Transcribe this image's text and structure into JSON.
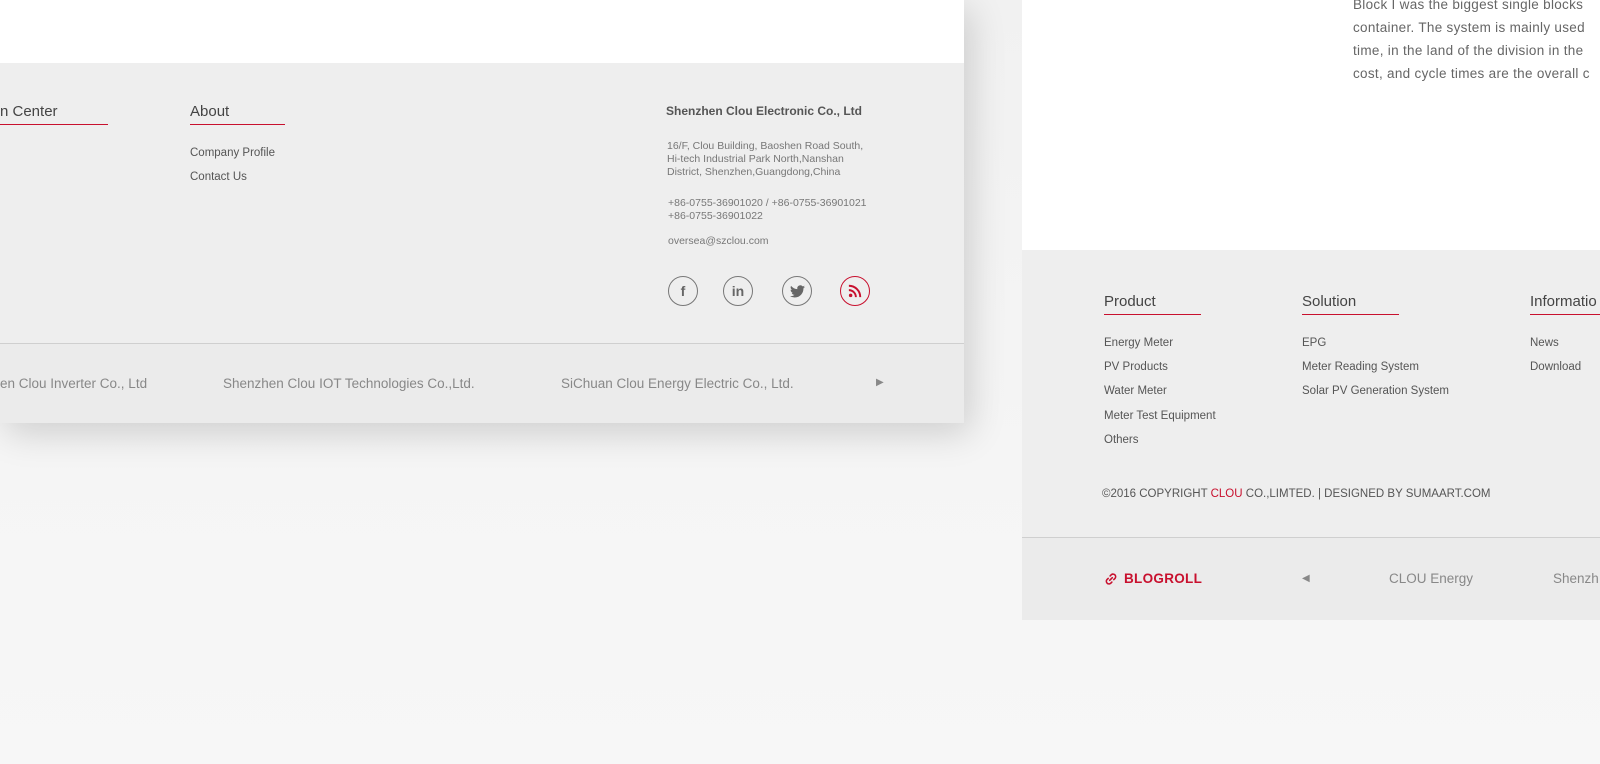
{
  "left_page": {
    "columns": [
      {
        "title": "n Center",
        "items": []
      },
      {
        "title": "About",
        "items": [
          "Company Profile",
          "Contact Us"
        ]
      }
    ],
    "company": {
      "name": "Shenzhen Clou Electronic Co., Ltd",
      "address": [
        "16/F, Clou Building, Baoshen Road South,",
        "Hi-tech Industrial Park North,Nanshan",
        "District, Shenzhen,Guangdong,China"
      ],
      "phones": [
        "+86-0755-36901020 / +86-0755-36901021",
        "+86-0755-36901022"
      ],
      "email": "oversea@szclou.com"
    },
    "social_icons": [
      "facebook-icon",
      "linkedin-icon",
      "twitter-icon",
      "rss-icon"
    ],
    "partner_links": [
      "en Clou Inverter Co., Ltd",
      "Shenzhen Clou IOT Technologies Co.,Ltd.",
      "SiChuan Clou Energy Electric Co., Ltd."
    ]
  },
  "right_page": {
    "intro_lines": [
      "Block I was the biggest single blocks",
      "container. The system is mainly used",
      "time, in the land of the division in the",
      "cost, and cycle times are the overall c"
    ],
    "columns": [
      {
        "title": "Product",
        "items": [
          "Energy Meter",
          "PV Products",
          "Water Meter",
          "Meter Test Equipment",
          "Others"
        ]
      },
      {
        "title": "Solution",
        "items": [
          "EPG",
          "Meter Reading System",
          "Solar PV Generation System"
        ]
      },
      {
        "title": "Informatio",
        "items": [
          "News",
          "Download"
        ]
      }
    ],
    "copyright": {
      "prefix": "©2016 COPYRIGHT ",
      "brand": "CLOU",
      "suffix": " CO.,LIMTED. | DESIGNED BY SUMAART.COM"
    },
    "blogroll_label": "BLOGROLL",
    "blogroll_links": [
      "CLOU Energy",
      "Shenzh"
    ]
  },
  "colors": {
    "accent": "#c8102e",
    "footer_bg": "#eeeeee",
    "page_bg": "#f4f4f4"
  }
}
